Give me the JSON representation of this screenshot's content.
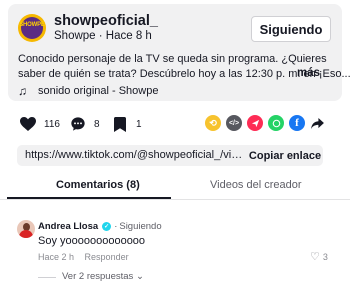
{
  "post": {
    "avatar_text": "SHOWPE",
    "username": "showpeoficial_",
    "author_name": "Showpe",
    "time_ago": "Hace 8 h",
    "meta_separator": " · ",
    "follow_label": "Siguiendo",
    "caption_line1": "Conocido personaje de la TV se queda sin programa. ¿Quieres",
    "caption_line2": "saber de quién se trata? Descúbrelo hoy a las 12:30 p. m. en ¡Eso...",
    "more_label": "más",
    "sound_icon": "music-note-icon",
    "sound": "sonido original - Showpe"
  },
  "actions": {
    "likes": "116",
    "comments": "8",
    "saves": "1"
  },
  "share": {
    "icons": [
      "repost-icon",
      "embed-icon",
      "tiktok-send-icon",
      "whatsapp-icon",
      "facebook-icon",
      "share-arrow-icon"
    ],
    "colors": {
      "repost": "#f7c32e",
      "embed": "#57585f",
      "send": "#fe2c55",
      "whatsapp": "#25d366",
      "facebook": "#1877f2"
    }
  },
  "link": {
    "url": "https://www.tiktok.com/@showpeoficial_/video/76...",
    "copy_label": "Copiar enlace"
  },
  "tabs": {
    "comments": "Comentarios (8)",
    "videos": "Videos del creador"
  },
  "comment": {
    "author": "Andrea Llosa",
    "separator": "·",
    "following": "Siguiendo",
    "text": "Soy yooooooooooooo",
    "time": "Hace 2 h",
    "reply_label": "Responder",
    "likes": "3",
    "view_replies": "Ver 2 respuestas"
  },
  "colors": {
    "accent": "#fe2c55",
    "verified": "#20d5ec",
    "text": "#161823",
    "muted": "#8a8b91"
  }
}
